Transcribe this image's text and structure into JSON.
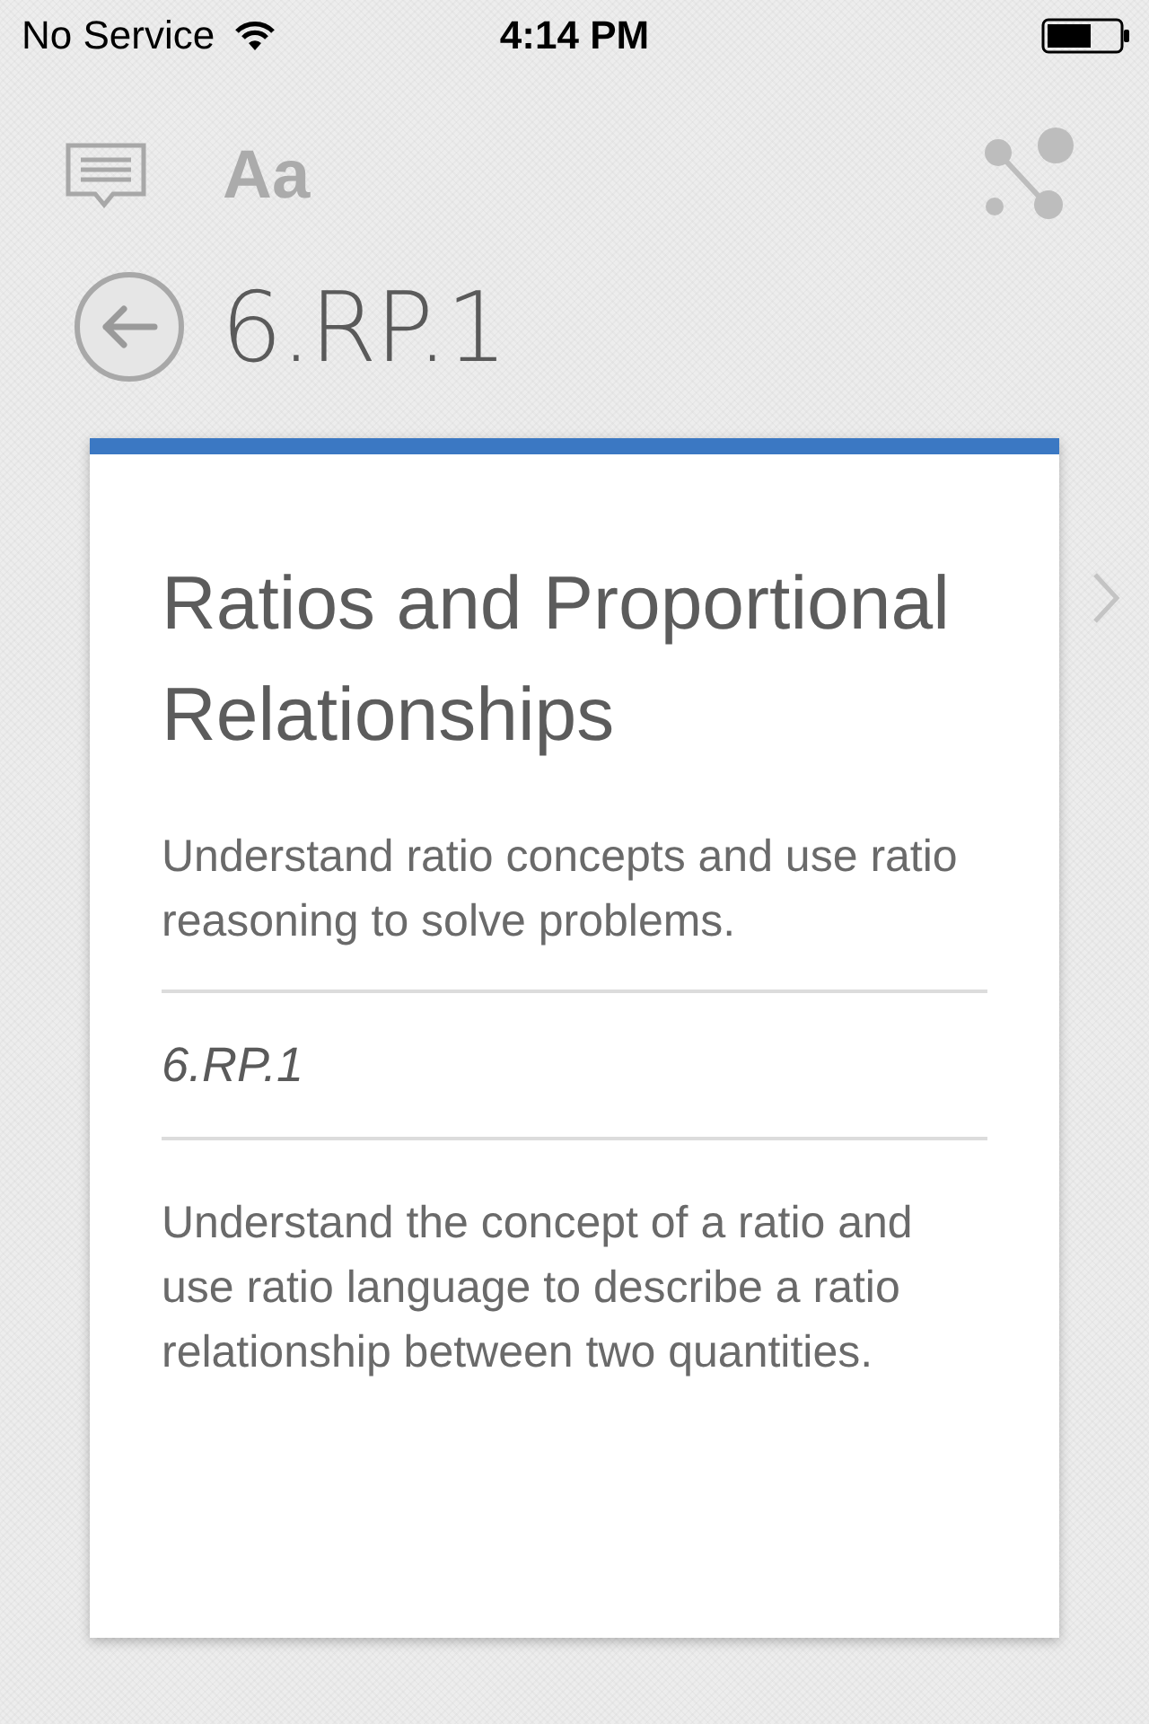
{
  "status_bar": {
    "carrier": "No Service",
    "time": "4:14 PM"
  },
  "toolbar": {
    "font_button": "Aa"
  },
  "header": {
    "title": "6.RP.1"
  },
  "card": {
    "domain": "Ratios and Proportional Relationships",
    "cluster": "Understand ratio concepts and use ratio reasoning to solve problems.",
    "code": "6.RP.1",
    "standard": "Understand the concept of a ratio and use ratio language to describe a ratio relationship between two quantities."
  }
}
